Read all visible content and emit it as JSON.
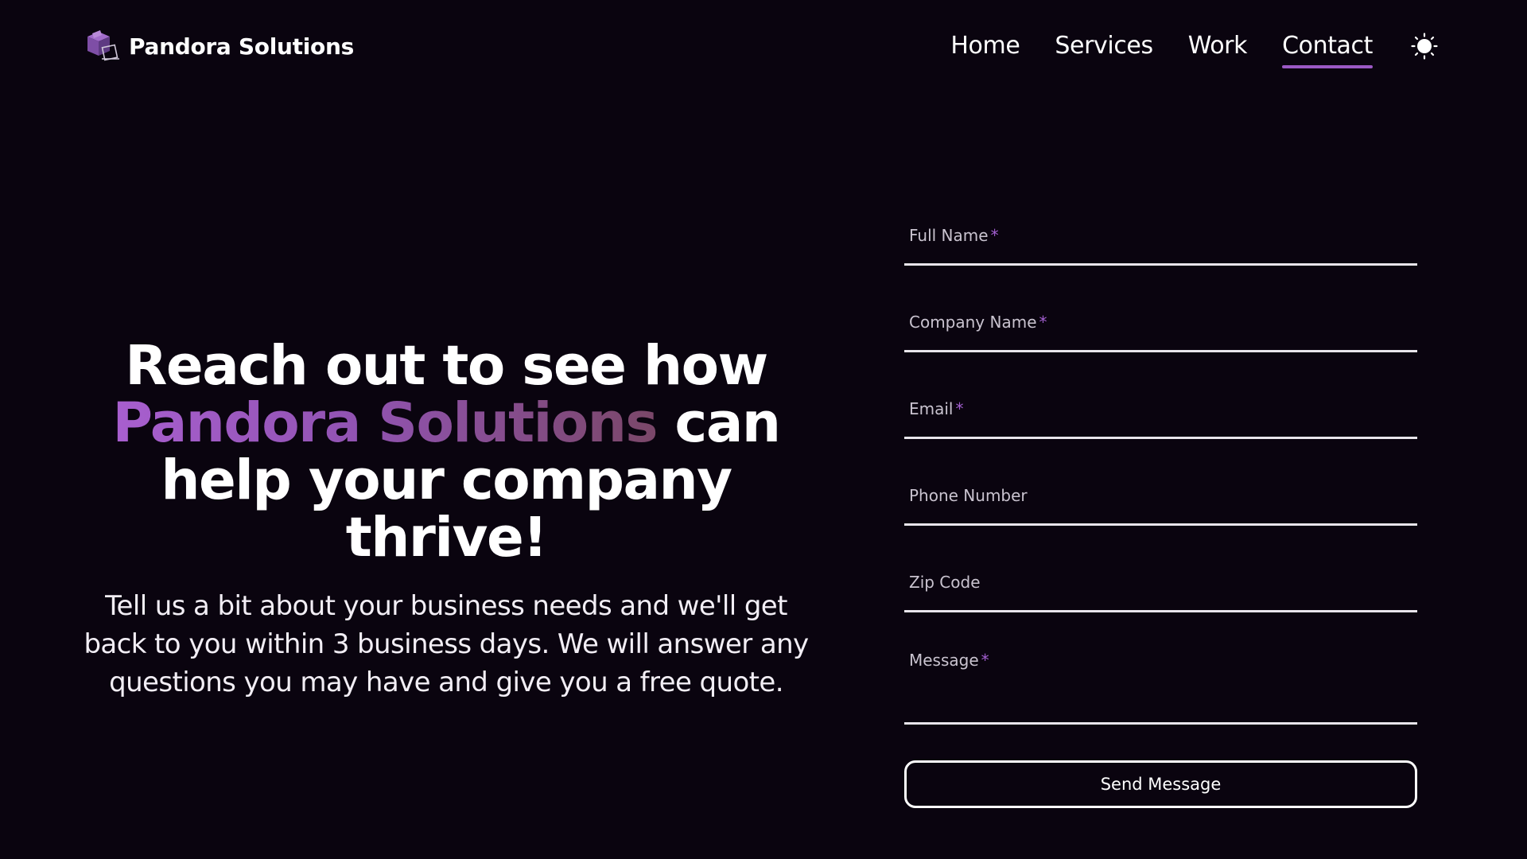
{
  "header": {
    "brand_name": "Pandora Solutions",
    "nav": {
      "home": "Home",
      "services": "Services",
      "work": "Work",
      "contact": "Contact"
    },
    "active_nav": "Contact",
    "theme_icon": "sun-icon"
  },
  "hero": {
    "title_line1": "Reach out to see how",
    "title_accent": "Pandora Solutions",
    "title_after_accent": " can",
    "title_line3": "help your company thrive!",
    "subtitle": "Tell us a bit about your business needs and we'll get back to you within 3 business days. We will answer any questions you may have and give you a free quote."
  },
  "form": {
    "full_name": {
      "label": "Full Name",
      "required": "*",
      "value": ""
    },
    "company_name": {
      "label": "Company Name",
      "required": "*",
      "value": ""
    },
    "email": {
      "label": "Email",
      "required": "*",
      "value": ""
    },
    "phone": {
      "label": "Phone Number",
      "value": ""
    },
    "zip": {
      "label": "Zip Code",
      "value": ""
    },
    "message": {
      "label": "Message",
      "required": "*",
      "value": ""
    },
    "submit_label": "Send Message"
  },
  "colors": {
    "background": "#0a040f",
    "accent": "#9b59c4",
    "accent_gradient_end": "#7a4768",
    "text": "#ffffff",
    "muted_label": "#c9c3cf"
  }
}
